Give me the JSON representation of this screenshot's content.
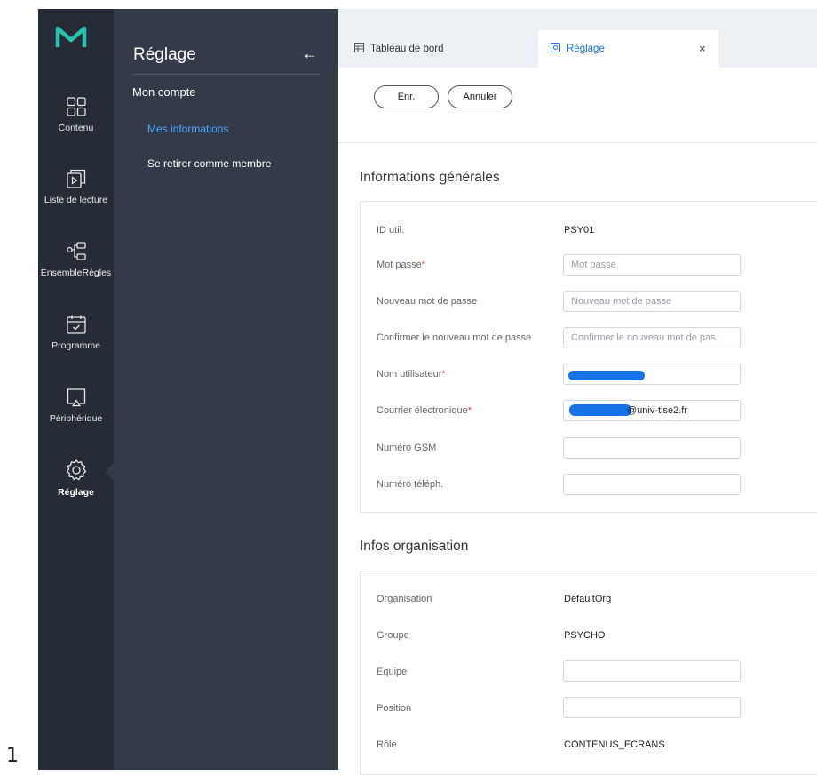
{
  "page_number": "1",
  "rail": {
    "items": [
      {
        "label": "Contenu",
        "icon": "grid-icon"
      },
      {
        "label": "Liste de lecture",
        "icon": "playlist-icon"
      },
      {
        "label": "EnsembleRègles",
        "icon": "ruleset-icon"
      },
      {
        "label": "Programme",
        "icon": "calendar-icon"
      },
      {
        "label": "Périphérique",
        "icon": "display-icon"
      },
      {
        "label": "Réglage",
        "icon": "gear-icon",
        "active": true
      }
    ]
  },
  "subpanel": {
    "title": "Réglage",
    "back_icon": "←",
    "section": "Mon compte",
    "links": [
      {
        "label": "Mes informations",
        "active": true
      },
      {
        "label": "Se retirer comme membre",
        "active": false
      }
    ]
  },
  "tabs": [
    {
      "label": "Tableau de bord",
      "icon": "dashboard-icon"
    },
    {
      "label": "Réglage",
      "icon": "settings-tab-icon",
      "close": "×"
    }
  ],
  "toolbar": {
    "save_label": "Enr.",
    "cancel_label": "Annuler"
  },
  "general": {
    "title": "Informations générales",
    "user_id_label": "ID util.",
    "user_id_value": "PSY01",
    "password_label": "Mot passe",
    "password_placeholder": "Mot passe",
    "new_password_label": "Nouveau mot de passe",
    "new_password_placeholder": "Nouveau mot de passe",
    "confirm_password_label": "Confirmer le nouveau mot de passe",
    "confirm_password_placeholder": "Confirmer le nouveau mot de pas",
    "username_label": "Nom utilisateur",
    "email_label": "Courrier électronique",
    "email_visible_suffix": "@univ-tlse2.fr",
    "gsm_label": "Numéro GSM",
    "phone_label": "Numéro téléph.",
    "required_mark": "*"
  },
  "organisation": {
    "title": "Infos organisation",
    "org_label": "Organisation",
    "org_value": "DefaultOrg",
    "group_label": "Groupe",
    "group_value": "PSYCHO",
    "team_label": "Equipe",
    "position_label": "Position",
    "role_label": "Rôle",
    "role_value": "CONTENUS_ECRANS"
  },
  "colors": {
    "rail_bg": "#262c35",
    "panel_bg": "#323b47",
    "accent": "#4ea3ff",
    "required": "#e04848",
    "redaction": "#1572e8",
    "logo_teal": "#29c2b0"
  }
}
